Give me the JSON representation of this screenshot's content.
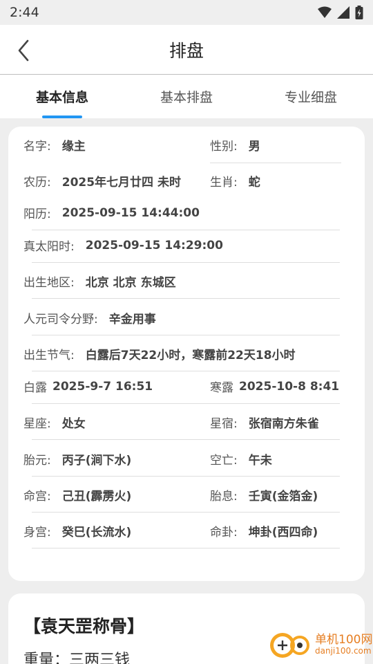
{
  "status_bar": {
    "time": "2:44"
  },
  "nav": {
    "title": "排盘"
  },
  "tabs": [
    {
      "label": "基本信息",
      "active": true
    },
    {
      "label": "基本排盘",
      "active": false
    },
    {
      "label": "专业细盘",
      "active": false
    }
  ],
  "info": {
    "name": {
      "label": "名字:",
      "value": "缘主"
    },
    "gender": {
      "label": "性别:",
      "value": "男"
    },
    "lunar": {
      "label": "农历:",
      "value": "2025年七月廿四 未时"
    },
    "zodiac": {
      "label": "生肖:",
      "value": "蛇"
    },
    "solar": {
      "label": "阳历:",
      "value": "2025-09-15 14:44:00"
    },
    "true_solar": {
      "label": "真太阳时:",
      "value": "2025-09-15 14:29:00"
    },
    "birthplace": {
      "label": "出生地区:",
      "value": "北京 北京 东城区"
    },
    "siling": {
      "label": "人元司令分野:",
      "value": "辛金用事"
    },
    "jieqi": {
      "label": "出生节气:",
      "value": "白露后7天22小时，寒露前22天18小时"
    },
    "bailu": {
      "label": "白露",
      "value": "2025-9-7 16:51"
    },
    "hanlu": {
      "label": "寒露",
      "value": "2025-10-8 8:41"
    },
    "constellation": {
      "label": "星座:",
      "value": "处女"
    },
    "xingxiu": {
      "label": "星宿:",
      "value": "张宿南方朱雀"
    },
    "taiyuan": {
      "label": "胎元:",
      "value": "丙子(涧下水)"
    },
    "kongwang": {
      "label": "空亡:",
      "value": "午未"
    },
    "minggong": {
      "label": "命宫:",
      "value": "己丑(霹雳火)"
    },
    "taixi": {
      "label": "胎息:",
      "value": "壬寅(金箔金)"
    },
    "shengong": {
      "label": "身宫:",
      "value": "癸巳(长流水)"
    },
    "minggua": {
      "label": "命卦:",
      "value": "坤卦(西四命)"
    }
  },
  "bone": {
    "title": "【袁天罡称骨】",
    "weight": "重量：三两三钱"
  },
  "watermark": {
    "cn": "单机100网",
    "en": "danji100.com"
  },
  "colors": {
    "accent": "#2196f3",
    "watermark": "#e67e22"
  }
}
